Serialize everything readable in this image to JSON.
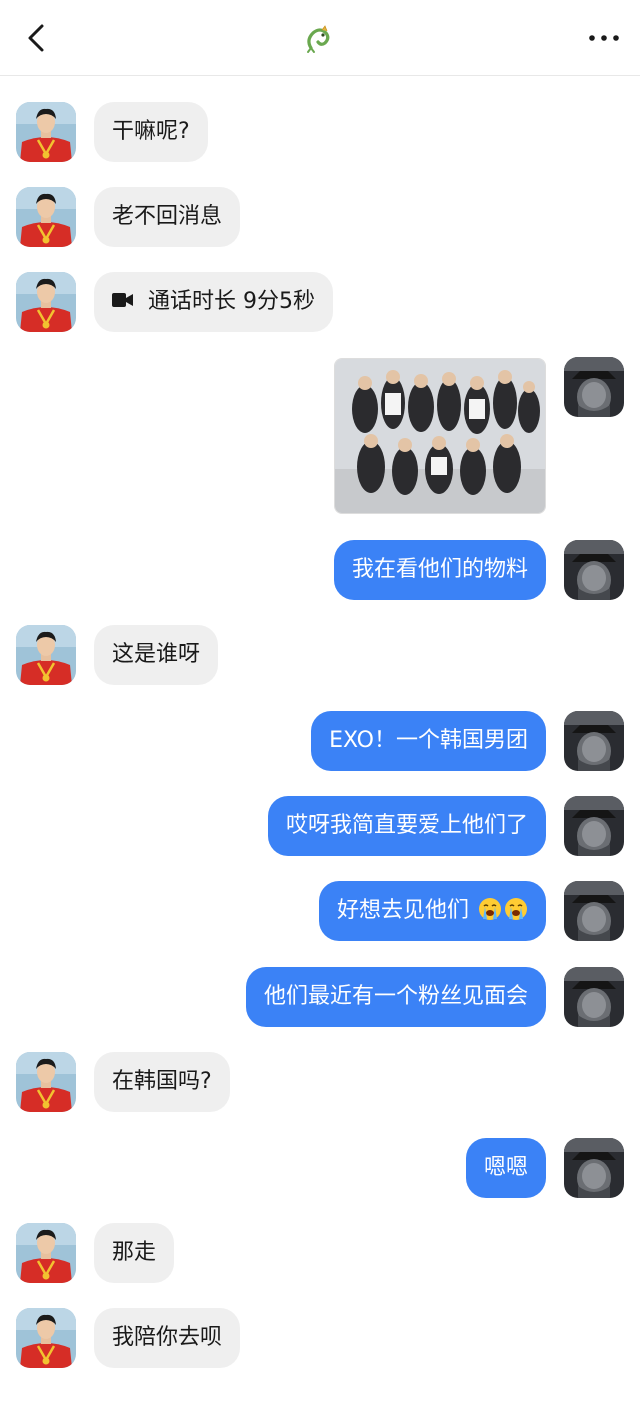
{
  "header": {
    "back_icon": "chevron-left-icon",
    "title_icon": "green-dragon-emblem-icon",
    "more_icon": "more-horizontal-icon"
  },
  "colors": {
    "outgoing_bubble": "#3b82f6",
    "incoming_bubble": "#efefef",
    "divider": "#e8e8e8"
  },
  "messages": [
    {
      "side": "in",
      "text": "干嘛呢?"
    },
    {
      "side": "in",
      "text": "老不回消息"
    },
    {
      "side": "in",
      "type": "call",
      "icon": "video-camera-icon",
      "text": "通话时长 9分5秒"
    },
    {
      "side": "out",
      "type": "image"
    },
    {
      "side": "out",
      "text": "我在看他们的物料"
    },
    {
      "side": "in",
      "text": "这是谁呀"
    },
    {
      "side": "out",
      "text": "EXO！一个韩国男团"
    },
    {
      "side": "out",
      "text": "哎呀我简直要爱上他们了"
    },
    {
      "side": "out",
      "text": "好想去见他们",
      "emoji_icon": "loudly-crying-face-icon"
    },
    {
      "side": "out",
      "text": "他们最近有一个粉丝见面会"
    },
    {
      "side": "in",
      "text": "在韩国吗?"
    },
    {
      "side": "out",
      "text": "嗯嗯"
    },
    {
      "side": "in",
      "text": "那走"
    },
    {
      "side": "in",
      "text": "我陪你去呗"
    }
  ]
}
